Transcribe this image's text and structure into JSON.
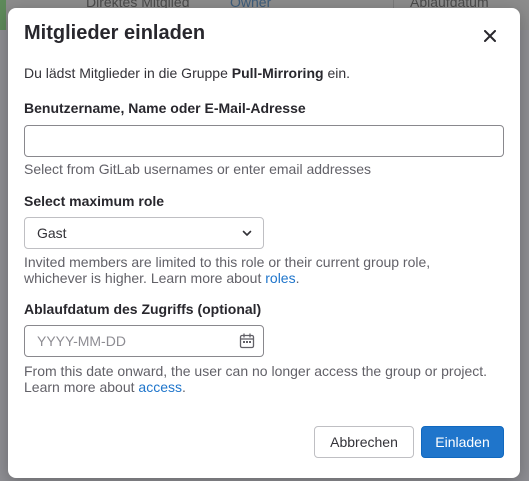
{
  "background": {
    "cells": [
      "Direktes Mitglied",
      "Owner",
      "Ablaufdatum"
    ]
  },
  "modal": {
    "title": "Mitglieder einladen",
    "close_icon": "close-icon",
    "intro_prefix": "Du lädst Mitglieder in die Gruppe ",
    "group_name": "Pull-Mirroring",
    "intro_suffix": " ein.",
    "username_label": "Benutzername, Name oder E-Mail-Adresse",
    "username_value": "",
    "username_help": "Select from GitLab usernames or enter email addresses",
    "role_label": "Select maximum role",
    "role_selected": "Gast",
    "role_help_prefix": "Invited members are limited to this role or their current group role, whichever is higher. Learn more about ",
    "role_help_link": "roles",
    "role_help_suffix": ".",
    "expiry_label": "Ablaufdatum des Zugriffs (optional)",
    "expiry_placeholder": "YYYY-MM-DD",
    "expiry_help_prefix": "From this date onward, the user can no longer access the group or project. Learn more about ",
    "expiry_help_link": "access",
    "expiry_help_suffix": ".",
    "cancel_label": "Abbrechen",
    "invite_label": "Einladen"
  },
  "colors": {
    "primary": "#1f75cb",
    "link": "#1f75cb",
    "overlay": "#8e8e93"
  }
}
